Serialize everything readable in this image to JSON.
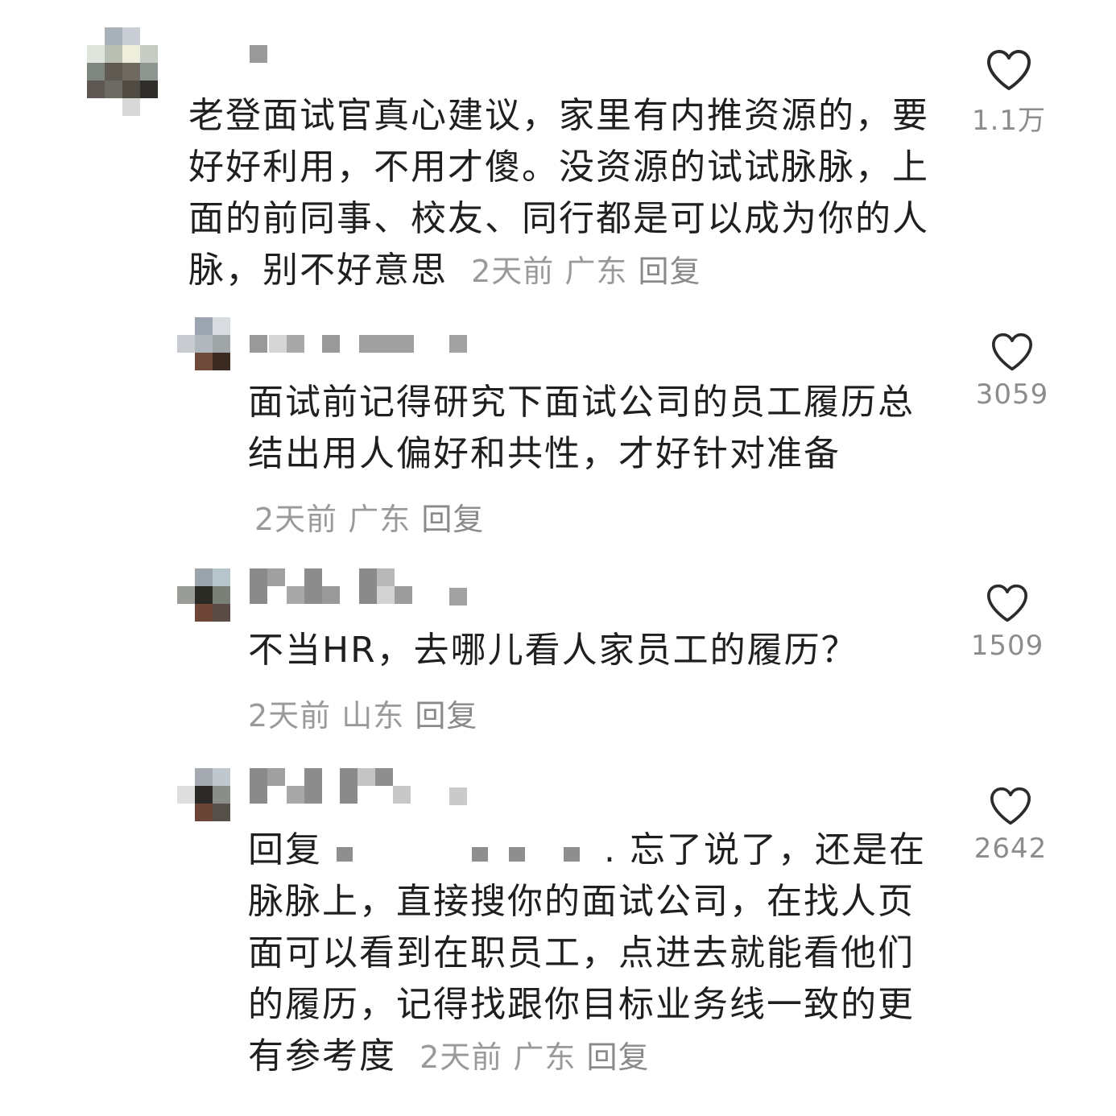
{
  "comments": [
    {
      "text": "老登面试官真心建议，家里有内推资源的，要好好利用，不用才傻。没资源的试试脉脉，上面的前同事、校友、同行都是可以成为你的人脉，别不好意思",
      "time": "2天前",
      "location": "广东",
      "reply_label": "回复",
      "likes": "1.1万"
    },
    {
      "text": "面试前记得研究下面试公司的员工履历总结出用人偏好和共性，才好针对准备",
      "time": "2天前",
      "location": "广东",
      "reply_label": "回复",
      "likes": "3059"
    },
    {
      "text": "不当HR，去哪儿看人家员工的履历？",
      "time": "2天前",
      "location": "山东",
      "reply_label": "回复",
      "likes": "1509"
    },
    {
      "reply_prefix": "回复",
      "text": ". 忘了说了，还是在脉脉上，直接搜你的面试公司，在找人页面可以看到在职员工，点进去就能看他们的履历，记得找跟你目标业务线一致的更有参考度",
      "time": "2天前",
      "location": "广东",
      "reply_label": "回复",
      "likes": "2642"
    }
  ],
  "icons": {
    "like": "heart-outline-icon"
  },
  "colors": {
    "text": "#1f1f1f",
    "meta": "#9a9a9a",
    "like_count": "#8c8c8c",
    "icon_stroke": "#2b2b2b"
  }
}
